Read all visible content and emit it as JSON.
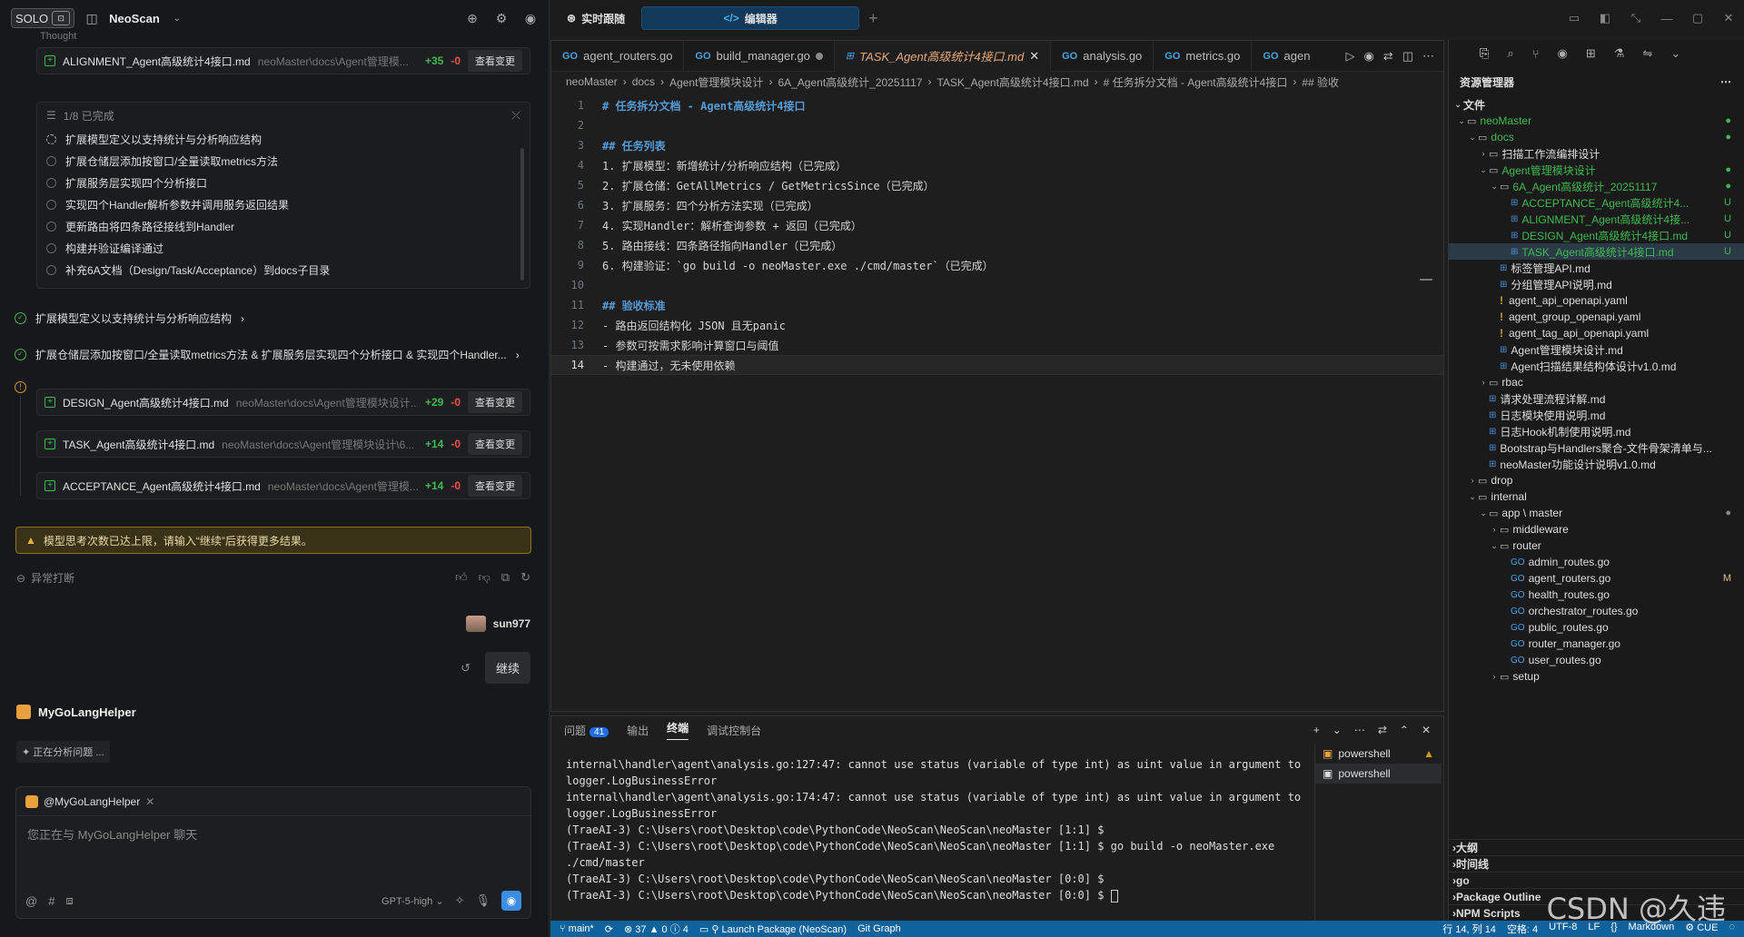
{
  "chat": {
    "solo": "SOLO",
    "project": "NeoScan",
    "thought": "Thought",
    "cards_top": [
      {
        "name": "ALIGNMENT_Agent高级统计4接口.md",
        "path": "neoMaster\\docs\\Agent管理模...",
        "plus": "+35",
        "minus": "-0",
        "btn": "查看变更"
      }
    ],
    "todo": {
      "header": "1/8 已完成",
      "items": [
        "扩展模型定义以支持统计与分析响应结构",
        "扩展仓储层添加按窗口/全量读取metrics方法",
        "扩展服务层实现四个分析接口",
        "实现四个Handler解析参数并调用服务返回结果",
        "更新路由将四条路径接线到Handler",
        "构建并验证编译通过",
        "补充6A文档（Design/Task/Acceptance）到docs子目录"
      ]
    },
    "steps": [
      "扩展模型定义以支持统计与分析响应结构",
      "扩展仓储层添加按窗口/全量读取metrics方法 & 扩展服务层实现四个分析接口 & 实现四个Handler..."
    ],
    "cards_bottom": [
      {
        "name": "DESIGN_Agent高级统计4接口.md",
        "path": "neoMaster\\docs\\Agent管理模块设计...",
        "plus": "+29",
        "minus": "-0",
        "btn": "查看变更"
      },
      {
        "name": "TASK_Agent高级统计4接口.md",
        "path": "neoMaster\\docs\\Agent管理模块设计\\6...",
        "plus": "+14",
        "minus": "-0",
        "btn": "查看变更"
      },
      {
        "name": "ACCEPTANCE_Agent高级统计4接口.md",
        "path": "neoMaster\\docs\\Agent管理模...",
        "plus": "+14",
        "minus": "-0",
        "btn": "查看变更"
      }
    ],
    "alert": "模型思考次数已达上限，请输入“继续”后获得更多结果。",
    "abnormal": "异常打断",
    "user": "sun977",
    "continue": "继续",
    "agent": "MyGoLangHelper",
    "analyzing": "正在分析问题 ...",
    "input_mention": "@MyGoLangHelper",
    "input_placeholder": "您正在与 MyGoLangHelper 聊天",
    "model": "GPT-5-high"
  },
  "ide": {
    "tab_live": "实时跟随",
    "tab_editor": "编辑器",
    "tabs": [
      {
        "name": "agent_routers.go",
        "type": "go"
      },
      {
        "name": "build_manager.go",
        "type": "go",
        "dirty": true
      },
      {
        "name": "TASK_Agent高级统计4接口.md",
        "type": "md",
        "active": true
      },
      {
        "name": "analysis.go",
        "type": "go"
      },
      {
        "name": "metrics.go",
        "type": "go"
      },
      {
        "name": "agen",
        "type": "go"
      }
    ],
    "breadcrumb": [
      "neoMaster",
      "docs",
      "Agent管理模块设计",
      "6A_Agent高级统计_20251117",
      "TASK_Agent高级统计4接口.md",
      "# 任务拆分文档 - Agent高级统计4接口",
      "## 验收"
    ],
    "code": [
      "# 任务拆分文档 - Agent高级统计4接口",
      "",
      "## 任务列表",
      "1. 扩展模型：新增统计/分析响应结构（已完成）",
      "2. 扩展仓储：GetAllMetrics / GetMetricsSince（已完成）",
      "3. 扩展服务：四个分析方法实现（已完成）",
      "4. 实现Handler：解析查询参数 + 返回（已完成）",
      "5. 路由接线：四条路径指向Handler（已完成）",
      "6. 构建验证：`go build -o neoMaster.exe ./cmd/master`（已完成）",
      "",
      "## 验收标准",
      "- 路由返回结构化 JSON 且无panic",
      "- 参数可按需求影响计算窗口与阈值",
      "- 构建通过，无未使用依赖"
    ],
    "panel_tabs": {
      "problems": "问题",
      "problems_count": "41",
      "output": "输出",
      "terminal": "终端",
      "debug": "调试控制台"
    },
    "terminal": [
      "internal\\handler\\agent\\analysis.go:127:47: cannot use status (variable of type int) as uint value in argument to logger.LogBusinessError",
      "internal\\handler\\agent\\analysis.go:174:47: cannot use status (variable of type int) as uint value in argument to logger.LogBusinessError",
      "(TraeAI-3) C:\\Users\\root\\Desktop\\code\\PythonCode\\NeoScan\\NeoScan\\neoMaster [1:1] $",
      "(TraeAI-3) C:\\Users\\root\\Desktop\\code\\PythonCode\\NeoScan\\NeoScan\\neoMaster [1:1] $ go build -o neoMaster.exe ./cmd/master",
      "(TraeAI-3) C:\\Users\\root\\Desktop\\code\\PythonCode\\NeoScan\\NeoScan\\neoMaster [0:0] $",
      "(TraeAI-3) C:\\Users\\root\\Desktop\\code\\PythonCode\\NeoScan\\NeoScan\\neoMaster [0:0] $"
    ],
    "shells": [
      "powershell",
      "powershell"
    ],
    "explorer": {
      "title": "资源管理器",
      "files": "文件",
      "rows": [
        {
          "d": 0,
          "k": "folder-open",
          "t": "neoMaster",
          "c": "green",
          "s": "●"
        },
        {
          "d": 1,
          "k": "folder-open",
          "t": "docs",
          "c": "green",
          "s": "●"
        },
        {
          "d": 2,
          "k": "folder",
          "t": "扫描工作流编排设计"
        },
        {
          "d": 2,
          "k": "folder-open",
          "t": "Agent管理模块设计",
          "c": "green",
          "s": "●"
        },
        {
          "d": 3,
          "k": "folder-open",
          "t": "6A_Agent高级统计_20251117",
          "c": "green",
          "s": "●"
        },
        {
          "d": 4,
          "k": "md",
          "t": "ACCEPTANCE_Agent高级统计4...",
          "c": "green",
          "s": "U"
        },
        {
          "d": 4,
          "k": "md",
          "t": "ALIGNMENT_Agent高级统计4接...",
          "c": "green",
          "s": "U"
        },
        {
          "d": 4,
          "k": "md",
          "t": "DESIGN_Agent高级统计4接口.md",
          "c": "green",
          "s": "U"
        },
        {
          "d": 4,
          "k": "md",
          "t": "TASK_Agent高级统计4接口.md",
          "c": "green",
          "s": "U",
          "sel": true
        },
        {
          "d": 3,
          "k": "md",
          "t": "标签管理API.md"
        },
        {
          "d": 3,
          "k": "md",
          "t": "分组管理API说明.md"
        },
        {
          "d": 3,
          "k": "yml",
          "t": "agent_api_openapi.yaml"
        },
        {
          "d": 3,
          "k": "yml",
          "t": "agent_group_openapi.yaml"
        },
        {
          "d": 3,
          "k": "yml",
          "t": "agent_tag_api_openapi.yaml"
        },
        {
          "d": 3,
          "k": "md",
          "t": "Agent管理模块设计.md"
        },
        {
          "d": 3,
          "k": "md",
          "t": "Agent扫描结果结构体设计v1.0.md"
        },
        {
          "d": 2,
          "k": "folder",
          "t": "rbac"
        },
        {
          "d": 2,
          "k": "md",
          "t": "请求处理流程详解.md"
        },
        {
          "d": 2,
          "k": "md",
          "t": "日志模块使用说明.md"
        },
        {
          "d": 2,
          "k": "md",
          "t": "日志Hook机制使用说明.md"
        },
        {
          "d": 2,
          "k": "md",
          "t": "Bootstrap与Handlers聚合-文件骨架清单与..."
        },
        {
          "d": 2,
          "k": "md",
          "t": "neoMaster功能设计说明v1.0.md"
        },
        {
          "d": 1,
          "k": "folder",
          "t": "drop"
        },
        {
          "d": 1,
          "k": "folder-open",
          "t": "internal"
        },
        {
          "d": 2,
          "k": "folder-open",
          "t": "app \\ master",
          "s": "●"
        },
        {
          "d": 3,
          "k": "folder",
          "t": "middleware"
        },
        {
          "d": 3,
          "k": "folder-open",
          "t": "router"
        },
        {
          "d": 4,
          "k": "go",
          "t": "admin_routes.go"
        },
        {
          "d": 4,
          "k": "go",
          "t": "agent_routers.go",
          "s": "M"
        },
        {
          "d": 4,
          "k": "go",
          "t": "health_routes.go"
        },
        {
          "d": 4,
          "k": "go",
          "t": "orchestrator_routes.go"
        },
        {
          "d": 4,
          "k": "go",
          "t": "public_routes.go"
        },
        {
          "d": 4,
          "k": "go",
          "t": "router_manager.go"
        },
        {
          "d": 4,
          "k": "go",
          "t": "user_routes.go"
        },
        {
          "d": 3,
          "k": "folder",
          "t": "setup"
        }
      ],
      "sections": [
        "大纲",
        "时间线",
        "go",
        "Package Outline",
        "NPM Scripts"
      ]
    },
    "status": {
      "branch": "main*",
      "errors": "37",
      "warnings": "0",
      "info": "4",
      "launch": "Launch Package (NeoScan)",
      "graph": "Git Graph",
      "pos": "行 14, 列 14",
      "spaces": "空格: 4",
      "enc": "UTF-8",
      "eol": "LF",
      "lang": "Markdown",
      "cue": "CUE"
    },
    "watermark": "CSDN @久违"
  }
}
